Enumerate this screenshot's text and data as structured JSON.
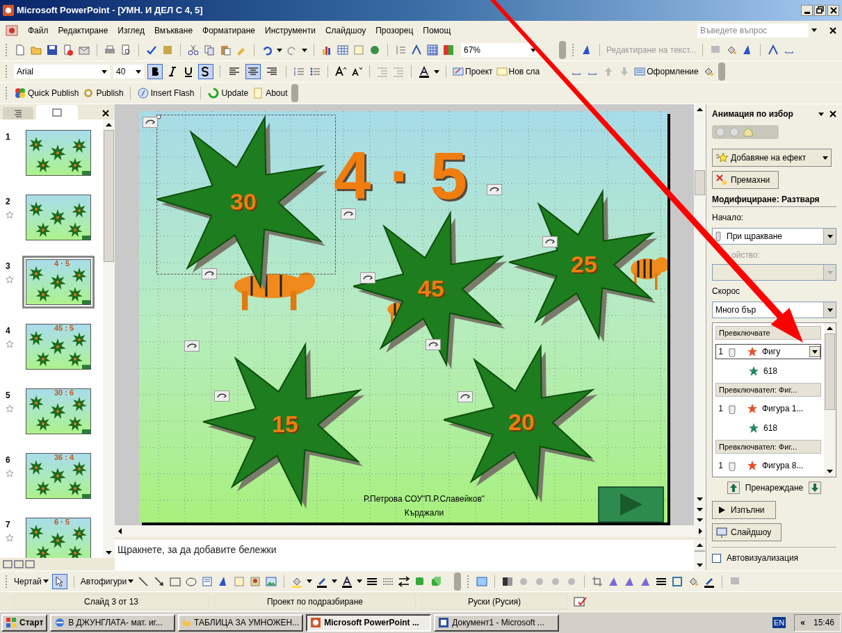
{
  "window": {
    "title": "Microsoft PowerPoint - [УМН. И ДЕЛ С 4, 5]"
  },
  "menu": {
    "items": [
      "Файл",
      "Редактиране",
      "Изглед",
      "Вмъкване",
      "Форматиране",
      "Инструменти",
      "Слайдшоу",
      "Прозорец",
      "Помощ"
    ],
    "help_placeholder": "Въведете въпрос"
  },
  "standard_toolbar": {
    "zoom": "67%",
    "edit_text": "Редактиране на текст..."
  },
  "formatting_toolbar": {
    "font": "Arial",
    "size": "40",
    "bold": true,
    "shadow": true,
    "align_center": true,
    "buttons": [
      "Проект",
      "Нов сла",
      "Оформление"
    ]
  },
  "addin_toolbar": {
    "buttons": [
      "Quick Publish",
      "Publish",
      "Insert Flash",
      "Update",
      "About"
    ]
  },
  "slides_pane": {
    "slides": [
      {
        "number": "1",
        "selected": false,
        "star": false
      },
      {
        "number": "2",
        "selected": false,
        "star": true
      },
      {
        "number": "3",
        "selected": true,
        "star": true,
        "title": "4 · 5"
      },
      {
        "number": "4",
        "selected": false,
        "star": true,
        "title": "45 : 5"
      },
      {
        "number": "5",
        "selected": false,
        "star": true,
        "title": "30 : 6"
      },
      {
        "number": "6",
        "selected": false,
        "star": true,
        "title": "36 : 4"
      },
      {
        "number": "7",
        "selected": false,
        "star": true,
        "title": "6 · 5"
      }
    ]
  },
  "slide": {
    "title": "4 · 5",
    "stars": [
      {
        "label": "30",
        "selected": true
      },
      {
        "label": "45",
        "selected": false
      },
      {
        "label": "25",
        "selected": false
      },
      {
        "label": "15",
        "selected": false
      },
      {
        "label": "20",
        "selected": false
      }
    ],
    "footer": [
      "Р.Петрова СОУ\"П.Р.Славейков\"",
      "Кърджали"
    ]
  },
  "notes": {
    "placeholder": "Щракнете, за да добавите бележки"
  },
  "task_pane": {
    "title": "Анимация по избор",
    "add_effect": "Добавяне на ефект",
    "remove": "Премахни",
    "modify": "Модифициране: Разтваря",
    "start_label": "Начало:",
    "start_value": "При щракване",
    "property_label": "ойство:",
    "speed_label": "Скорос",
    "speed_value": "Много бър",
    "groups": [
      {
        "trigger": "Превключвате",
        "items": [
          {
            "kind": "click",
            "order": "1",
            "effect": "Фигу",
            "selected": true
          },
          {
            "kind": "after",
            "effect": "618",
            "selected": false
          }
        ]
      },
      {
        "trigger": "Превключвател: Фиг...",
        "items": [
          {
            "kind": "click",
            "order": "1",
            "effect": "Фигура 1...",
            "selected": false
          },
          {
            "kind": "after",
            "effect": "618",
            "selected": false
          }
        ]
      },
      {
        "trigger": "Превключвател: Фиг...",
        "items": [
          {
            "kind": "click",
            "order": "1",
            "effect": "Фигура 8...",
            "selected": false
          }
        ]
      }
    ],
    "reorder": "Пренареждане",
    "play": "Изпълни",
    "slideshow": "Слайдшоу",
    "autopreview": {
      "label": "Автовизуализация",
      "checked": false
    }
  },
  "drawing_toolbar": {
    "draw": "Чертай",
    "autoshapes": "Автофигури"
  },
  "status_bar": [
    "Слайд 3 от 13",
    "Проект по подразбиране",
    "Руски (Русия)"
  ],
  "taskbar": {
    "start": "Старт",
    "tasks": [
      {
        "label": "В ДЖУНГЛАТА- мат. иг...",
        "selected": false
      },
      {
        "label": "ТАБЛИЦА ЗА УМНОЖЕН...",
        "selected": false
      },
      {
        "label": "Microsoft PowerPoint ...",
        "selected": true
      },
      {
        "label": "Документ1 - Microsoft ...",
        "selected": false
      }
    ],
    "language": "EN",
    "chevron": "«",
    "clock": "15:46"
  }
}
